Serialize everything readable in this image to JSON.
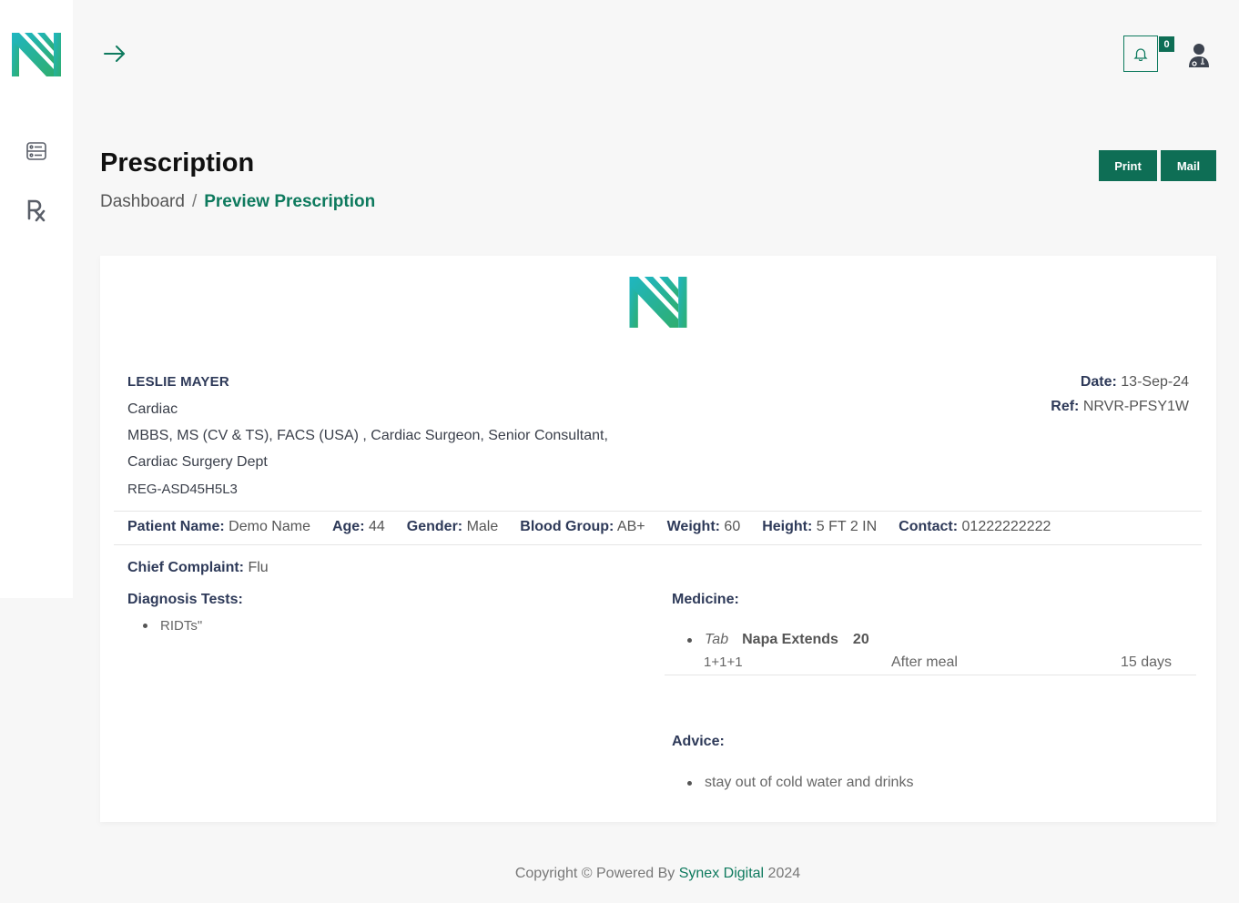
{
  "header": {
    "notification_count": "0"
  },
  "page": {
    "title": "Prescription",
    "breadcrumb": {
      "home": "Dashboard",
      "separator": "/",
      "current": "Preview Prescription"
    }
  },
  "actions": {
    "print_label": "Print",
    "mail_label": "Mail"
  },
  "doctor": {
    "name": "LESLIE MAYER",
    "department": "Cardiac",
    "qualifications": "MBBS, MS (CV & TS), FACS (USA) , Cardiac Surgeon, Senior Consultant,",
    "unit": "Cardiac Surgery Dept",
    "reg": "REG-ASD45H5L3"
  },
  "meta": {
    "date_label": "Date:",
    "date_value": "13-Sep-24",
    "ref_label": "Ref:",
    "ref_value": "NRVR-PFSY1W"
  },
  "patient": {
    "name_label": "Patient Name:",
    "name": "Demo Name",
    "age_label": "Age:",
    "age": "44",
    "gender_label": "Gender:",
    "gender": "Male",
    "blood_label": "Blood Group:",
    "blood": "AB+",
    "weight_label": "Weight:",
    "weight": "60",
    "height_label": "Height:",
    "height": "5 FT 2 IN",
    "contact_label": "Contact:",
    "contact": "01222222222"
  },
  "complaint": {
    "label": "Chief Complaint:",
    "value": "Flu"
  },
  "diagnosis": {
    "label": "Diagnosis Tests:",
    "items": [
      "RIDTs\""
    ]
  },
  "medicine": {
    "label": "Medicine:",
    "items": [
      {
        "form": "Tab",
        "name": "Napa Extends",
        "strength": "20",
        "dose": "1+1+1",
        "timing": "After meal",
        "duration": "15 days"
      }
    ]
  },
  "advice": {
    "label": "Advice:",
    "items": [
      "stay out of cold water and drinks"
    ]
  },
  "footer": {
    "prefix": "Copyright © Powered By",
    "brand": "Synex Digital",
    "year": "2024"
  },
  "colors": {
    "primary": "#0e6e55",
    "accent_teal": "#2cb7a8",
    "accent_green": "#2ea37a"
  }
}
